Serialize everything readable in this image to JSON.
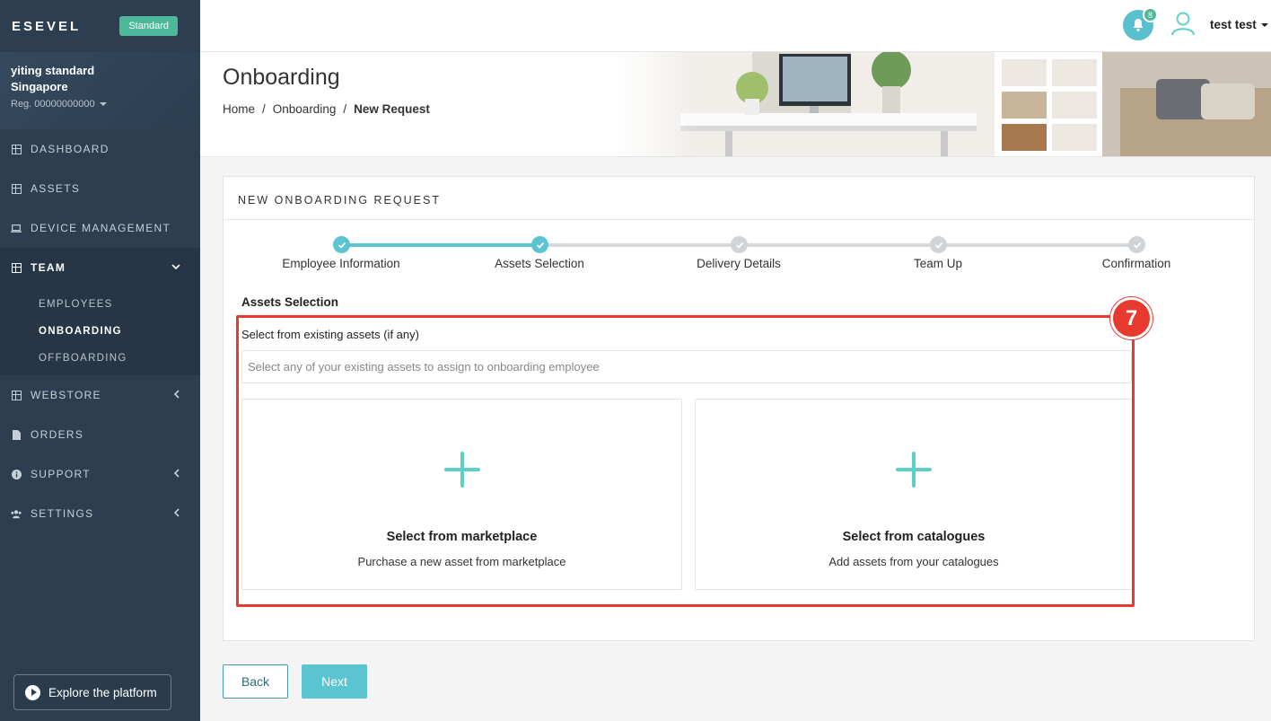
{
  "app": {
    "brand": "ESEVEL",
    "plan": "Standard"
  },
  "org": {
    "name_line1": "yiting standard",
    "name_line2": "Singapore",
    "reg": "Reg. 00000000000"
  },
  "sidebar": {
    "items": [
      {
        "label": "DASHBOARD",
        "icon": "grid-icon"
      },
      {
        "label": "ASSETS",
        "icon": "grid-icon"
      },
      {
        "label": "DEVICE MANAGEMENT",
        "icon": "laptop-icon"
      },
      {
        "label": "TEAM",
        "icon": "grid-icon",
        "expanded": true
      },
      {
        "label": "WEBSTORE",
        "icon": "grid-icon"
      },
      {
        "label": "ORDERS",
        "icon": "document-icon"
      },
      {
        "label": "SUPPORT",
        "icon": "info-icon"
      },
      {
        "label": "SETTINGS",
        "icon": "users-icon"
      }
    ],
    "team_sub": [
      "EMPLOYEES",
      "ONBOARDING",
      "OFFBOARDING"
    ],
    "explore": "Explore the platform"
  },
  "topbar": {
    "notification_count": "8",
    "user_name": "test test"
  },
  "header": {
    "title": "Onboarding",
    "breadcrumb": [
      "Home",
      "Onboarding",
      "New Request"
    ]
  },
  "card": {
    "title": "NEW ONBOARDING REQUEST",
    "steps": [
      {
        "label": "Employee Information",
        "state": "done"
      },
      {
        "label": "Assets Selection",
        "state": "done"
      },
      {
        "label": "Delivery Details",
        "state": "pending"
      },
      {
        "label": "Team Up",
        "state": "pending"
      },
      {
        "label": "Confirmation",
        "state": "pending"
      }
    ],
    "section_title": "Assets Selection",
    "field_label": "Select from existing assets (if any)",
    "field_placeholder": "Select any of your existing assets to assign to onboarding employee",
    "options": [
      {
        "title": "Select from marketplace",
        "desc": "Purchase a new asset from marketplace"
      },
      {
        "title": "Select from catalogues",
        "desc": "Add assets from your catalogues"
      }
    ]
  },
  "annotation": {
    "step_number": "7"
  },
  "actions": {
    "back": "Back",
    "next": "Next"
  },
  "colors": {
    "sidebar": "#2c3e50",
    "accent": "#5bc4d1",
    "plus": "#5ed1c6",
    "annotation": "#e8392e",
    "badge": "#4db89a"
  }
}
